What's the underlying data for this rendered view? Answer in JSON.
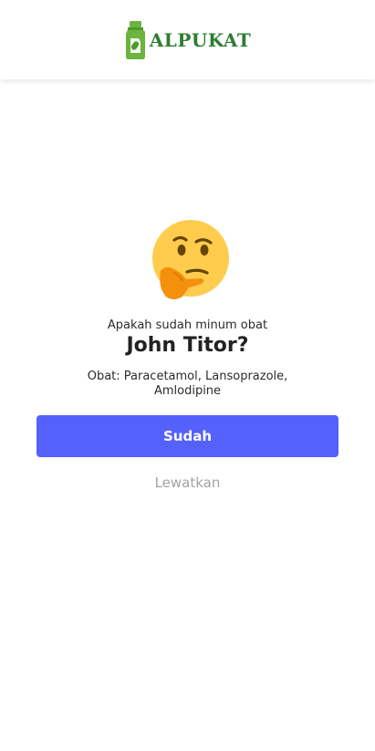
{
  "header": {
    "brand_name": "ALPUKAT",
    "brand_color": "#2e7d32"
  },
  "reminder": {
    "emoji": "thinking-face-emoji",
    "question": "Apakah sudah minum obat",
    "person": "John Titor?",
    "medicines_line1": "Obat: Paracetamol, Lansoprazole,",
    "medicines_line2": "Amlodipine"
  },
  "actions": {
    "done_label": "Sudah",
    "done_color": "#5461fb",
    "skip_label": "Lewatkan",
    "skip_color": "#a3a3a3"
  }
}
